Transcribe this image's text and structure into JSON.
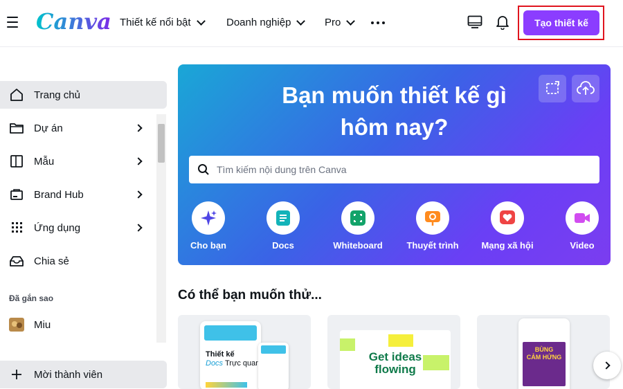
{
  "header": {
    "logo": "Canva",
    "nav": [
      "Thiết kế nổi bật",
      "Doanh nghiệp",
      "Pro"
    ],
    "create_button": "Tạo thiết kế"
  },
  "sidebar": {
    "items": [
      {
        "label": "Trang chủ",
        "icon": "home-icon"
      },
      {
        "label": "Dự án",
        "icon": "folder-icon"
      },
      {
        "label": "Mẫu",
        "icon": "template-icon"
      },
      {
        "label": "Brand Hub",
        "icon": "brand-icon"
      },
      {
        "label": "Ứng dụng",
        "icon": "apps-icon"
      },
      {
        "label": "Chia sẻ",
        "icon": "share-icon"
      }
    ],
    "starred_title": "Đã gắn sao",
    "starred_item": "Miu",
    "invite": "Mời thành viên"
  },
  "hero": {
    "title_line1": "Bạn muốn thiết kế gì",
    "title_line2": "hôm nay?",
    "search_placeholder": "Tìm kiếm nội dung trên Canva",
    "categories": [
      "Cho bạn",
      "Docs",
      "Whiteboard",
      "Thuyết trình",
      "Mạng xã hội",
      "Video"
    ]
  },
  "suggestions": {
    "title": "Có thể bạn muốn thử...",
    "card1_line1": "Thiết kế",
    "card1_line2": "Docs",
    "card1_line3": "Trực quan",
    "card2_line1": "Get ideas",
    "card2_line2": "flowing",
    "card3_line1": "BÙNG",
    "card3_line2": "CẢM HỨNG"
  },
  "colors": {
    "accent": "#8b3dff",
    "highlight_border": "#e0141e"
  }
}
